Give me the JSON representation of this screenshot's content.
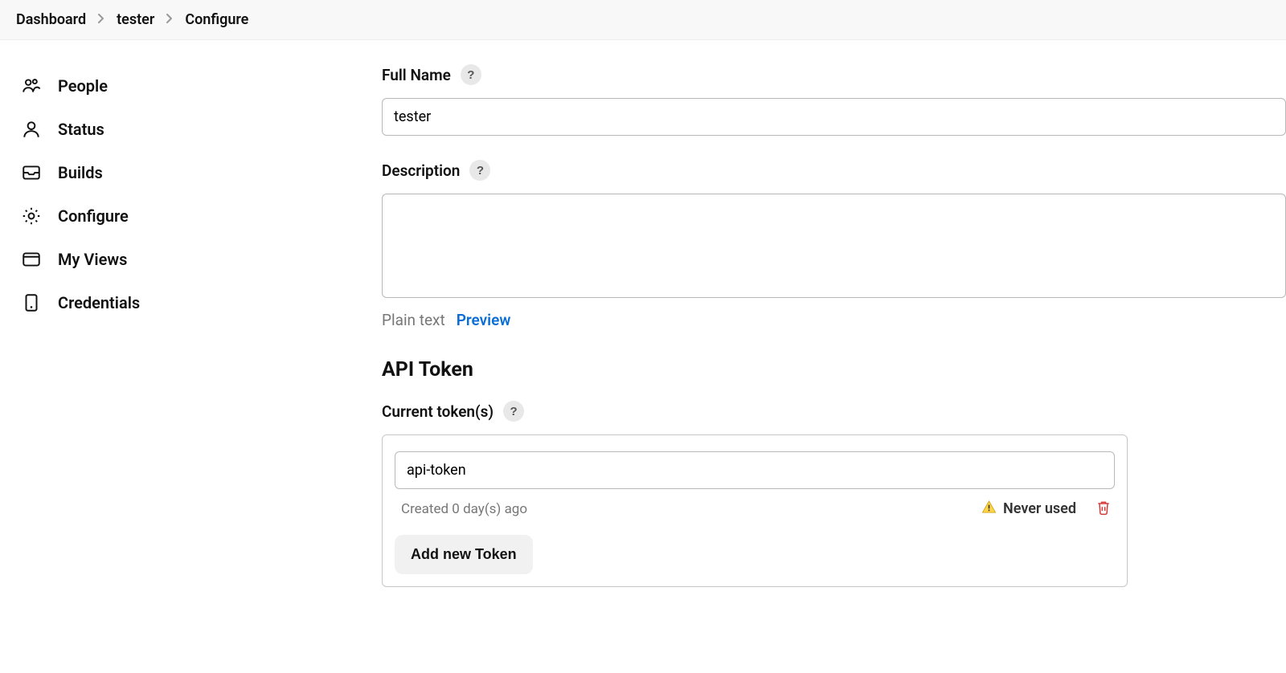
{
  "breadcrumb": {
    "items": [
      "Dashboard",
      "tester",
      "Configure"
    ]
  },
  "sidebar": {
    "items": [
      {
        "label": "People"
      },
      {
        "label": "Status"
      },
      {
        "label": "Builds"
      },
      {
        "label": "Configure"
      },
      {
        "label": "My Views"
      },
      {
        "label": "Credentials"
      }
    ]
  },
  "form": {
    "fullName": {
      "label": "Full Name",
      "value": "tester"
    },
    "description": {
      "label": "Description",
      "value": "",
      "plain": "Plain text",
      "preview": "Preview"
    },
    "apiToken": {
      "heading": "API Token",
      "currentLabel": "Current token(s)",
      "tokenName": "api-token",
      "created": "Created 0 day(s) ago",
      "neverUsed": "Never used",
      "addButton": "Add new Token"
    }
  },
  "help": "?"
}
